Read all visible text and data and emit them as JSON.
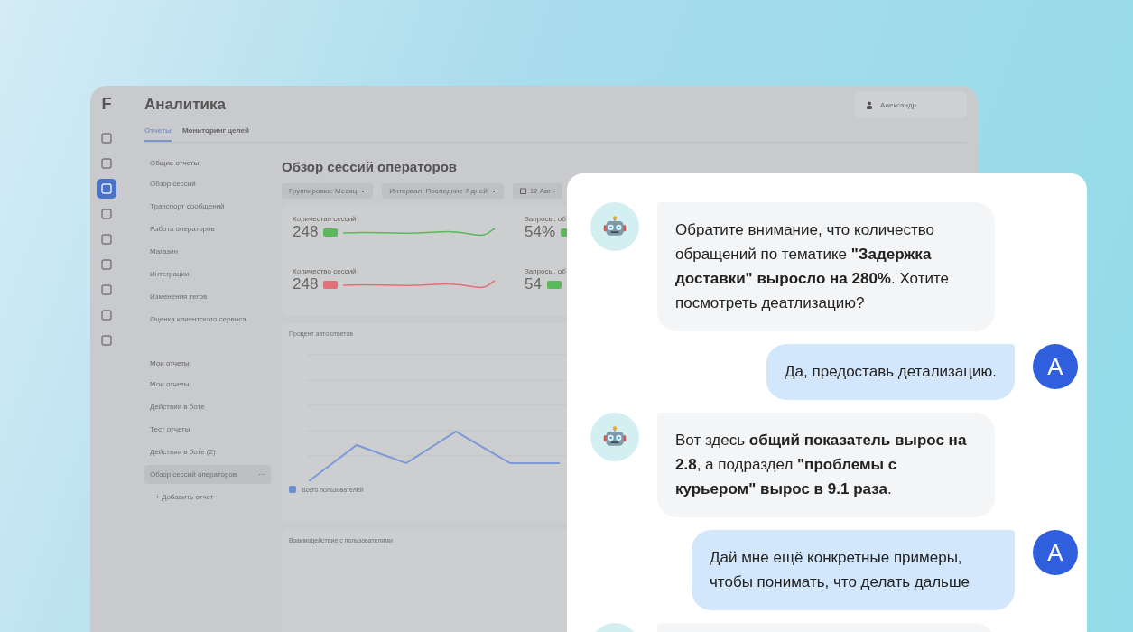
{
  "dashboard": {
    "logo": "F",
    "title": "Аналитика",
    "rail": [
      {
        "selected": false
      },
      {
        "selected": false
      },
      {
        "selected": true
      },
      {
        "selected": false
      },
      {
        "selected": false
      },
      {
        "selected": false
      },
      {
        "selected": false
      },
      {
        "selected": false
      },
      {
        "selected": false
      }
    ],
    "user": {
      "name": "Александр"
    },
    "tabs": [
      {
        "label": "Отчеты",
        "selected": true
      },
      {
        "label": "Мониторинг целей",
        "selected": false
      }
    ],
    "sections": [
      {
        "heading": "Общие отчеты",
        "items": [
          {
            "label": "Обзор сессий",
            "selected": false
          },
          {
            "label": "Транспорт сообщений",
            "selected": false
          },
          {
            "label": "Работа операторов",
            "selected": false
          },
          {
            "label": "Магазин",
            "selected": false
          },
          {
            "label": "Интеграции",
            "selected": false
          },
          {
            "label": "Изменения тегов",
            "selected": false
          },
          {
            "label": "Оценка клиентского сервиса",
            "selected": false
          }
        ]
      },
      {
        "heading": "Мои отчеты",
        "items": [
          {
            "label": "Мои отчеты",
            "selected": false
          },
          {
            "label": "Действия в боте",
            "selected": false
          },
          {
            "label": "Тест отчеты",
            "selected": false
          },
          {
            "label": "Действия в боте (2)",
            "selected": false
          },
          {
            "label": "Обзор сессий операторов",
            "selected": true
          }
        ]
      }
    ],
    "item_menu": "⋯",
    "add_icon": "+",
    "add_report": "Добавить отчет",
    "report_title": "Обзор сессий операторов",
    "filters": [
      {
        "label": "Группировка: Месяц",
        "kind": "dropdown"
      },
      {
        "label": "Интервал: Последние 7 дней",
        "kind": "dropdown"
      },
      {
        "label": "12 Авг -",
        "kind": "date"
      }
    ],
    "stats": [
      {
        "label": "Количество сессий",
        "value": "248",
        "color": "#5cb85c"
      },
      {
        "label": "Запросы, об",
        "value": "54%",
        "color": "#5cb85c"
      },
      {
        "label": "Количество сессий",
        "value": "248",
        "color": "#e0707a"
      },
      {
        "label": "Запросы, об",
        "value": "54",
        "color": "#5cb85c"
      }
    ],
    "charts": [
      {
        "title": "Процент авто ответов",
        "legend": "Всего пользователей"
      },
      {
        "title": "Взаимодействие с пользователями"
      }
    ]
  },
  "chat": {
    "messages": [
      {
        "kind": "bot",
        "text": "Обратите внимание, что количество обращений по тематике **\"Задержка доставки\" выросло на 280%**. Хотите посмотреть деатлизацию?"
      },
      {
        "kind": "user",
        "avatar": "A",
        "text": "Да, предоставь детализацию."
      },
      {
        "kind": "bot",
        "text": "Вот здесь **общий показатель вырос на 2.8**, а подраздел **\"проблемы с курьером\" вырос в 9.1 раза**."
      },
      {
        "kind": "user",
        "avatar": "A",
        "text": "Дай мне ещё конкретные примеры, чтобы понимать, что делать дальше"
      },
      {
        "kind": "bot"
      }
    ]
  }
}
